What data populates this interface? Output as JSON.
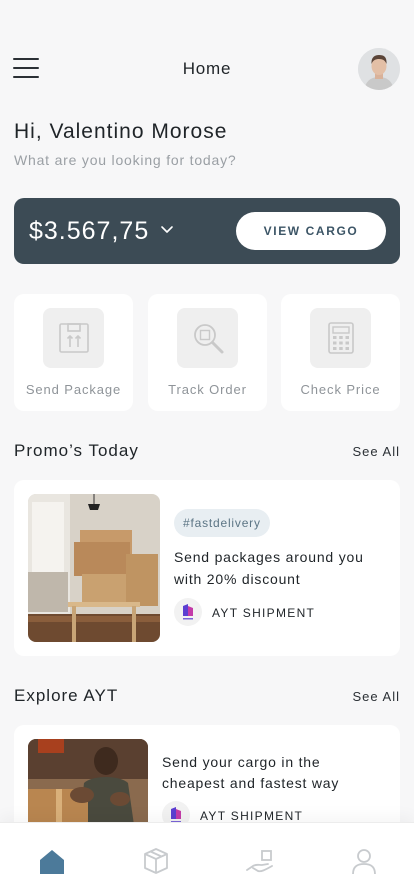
{
  "header": {
    "title": "Home",
    "menu_icon": "hamburger-menu-icon",
    "avatar": "user-avatar"
  },
  "greeting": {
    "title": "Hi, Valentino Morose",
    "subtitle": "What are you looking for today?"
  },
  "balance": {
    "amount": "$3.567,75",
    "dropdown_icon": "chevron-down-icon",
    "button_label": "VIEW CARGO"
  },
  "actions": [
    {
      "label": "Send Package",
      "icon": "package-icon"
    },
    {
      "label": "Track Order",
      "icon": "magnifier-icon"
    },
    {
      "label": "Check Price",
      "icon": "calculator-icon"
    }
  ],
  "promos": {
    "title": "Promo’s Today",
    "see_all": "See All",
    "item": {
      "tag": "#fastdelivery",
      "text": "Send packages around you with 20% discount",
      "brand": "AYT SHIPMENT"
    }
  },
  "explore": {
    "title": "Explore AYT",
    "see_all": "See All",
    "item": {
      "text": "Send your cargo in the cheapest and fastest way",
      "brand": "AYT SHIPMENT"
    }
  },
  "tabbar": {
    "tabs": [
      {
        "name": "home-icon",
        "active": true
      },
      {
        "name": "box-icon",
        "active": false
      },
      {
        "name": "delivery-icon",
        "active": false
      },
      {
        "name": "profile-icon",
        "active": false
      }
    ]
  },
  "colors": {
    "accent": "#3c4b55",
    "active_tab": "#4c7a9a",
    "inactive_tab": "#c8cbce",
    "background": "#f7f7f8"
  }
}
